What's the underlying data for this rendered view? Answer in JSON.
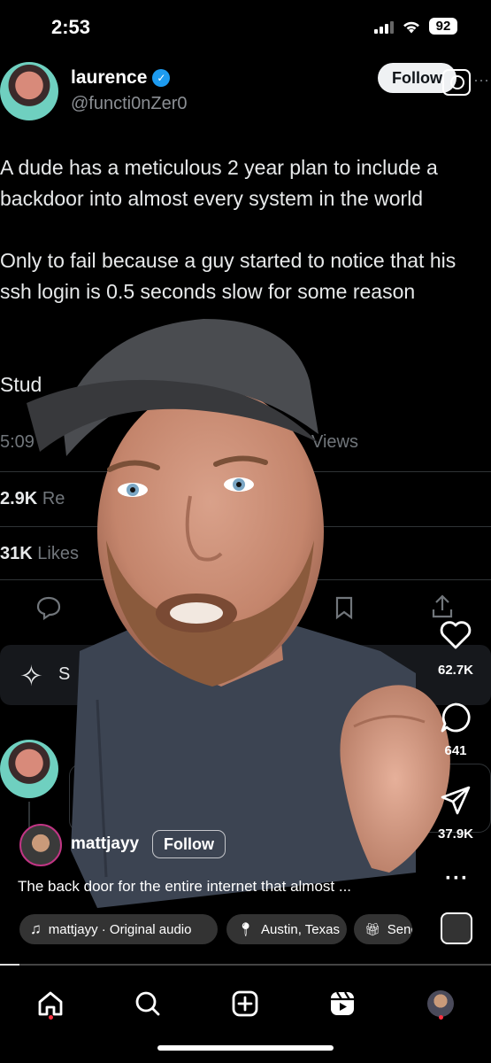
{
  "status_bar": {
    "time": "2:53",
    "battery": "92"
  },
  "tweet": {
    "name": "laurence",
    "handle": "@functi0nZer0",
    "follow_label": "Follow",
    "text_line1": "A dude has a meticulous 2 year plan to include a backdoor into almost every system in the world",
    "text_line2": "Only to fail because a guy started to notice that his ssh login is 0.5 seconds slow for some reason",
    "text_line3": "Stud",
    "meta_time": "5:09",
    "views_fragment": "Views",
    "reposts_count": "2.9K",
    "reposts_label": "Re",
    "likes_count": "31K",
    "likes_label": "Likes",
    "grok_fragment": "S"
  },
  "reel": {
    "likes": "62.7K",
    "comments": "641",
    "shares": "37.9K",
    "username": "mattjayy",
    "follow_label": "Follow",
    "caption": "The back door for the entire internet that almost ...",
    "audio_chip": "mattjayy · Original audio",
    "location_chip": "Austin, Texas",
    "send_chip": "Send",
    "progress": 0.04
  },
  "colors": {
    "accent_blue": "#1d9bf0",
    "notification_red": "#ff3040"
  },
  "nav": {
    "items": [
      "home-icon",
      "search-icon",
      "create-icon",
      "reels-icon",
      "profile-avatar"
    ]
  }
}
